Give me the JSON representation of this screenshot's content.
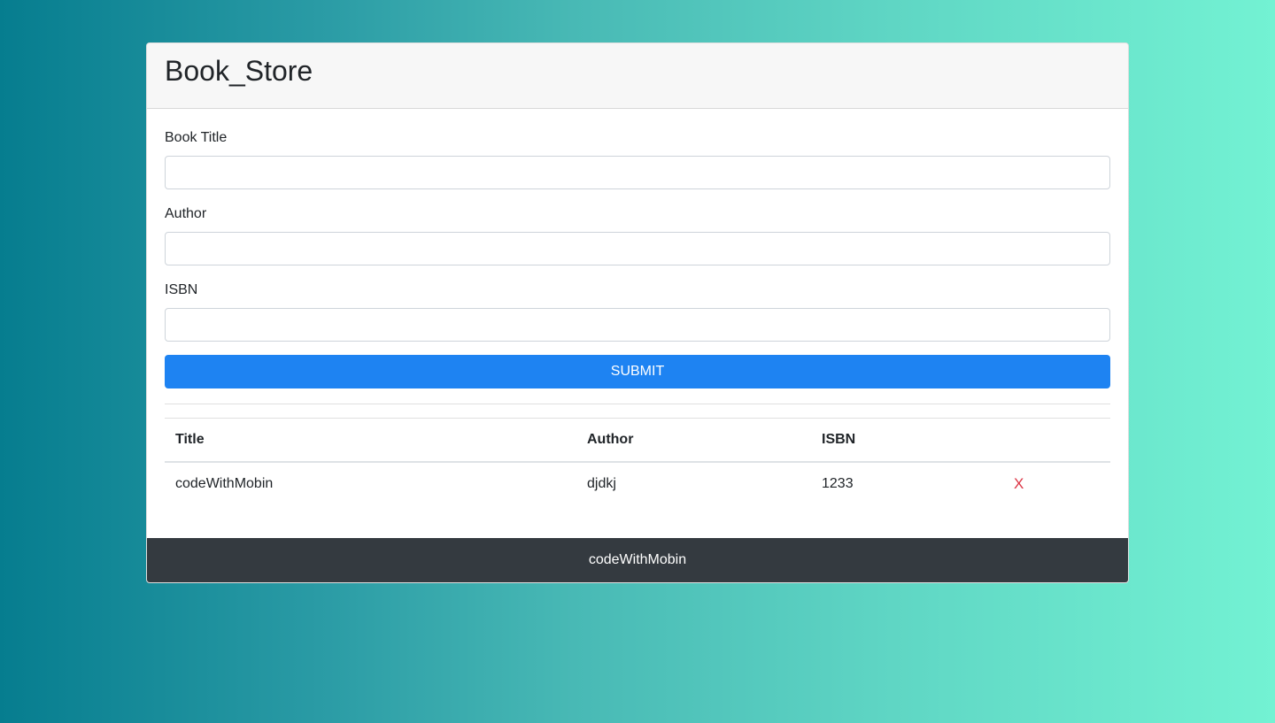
{
  "header": {
    "title": "Book_Store"
  },
  "form": {
    "title_label": "Book Title",
    "title_value": "",
    "author_label": "Author",
    "author_value": "",
    "isbn_label": "ISBN",
    "isbn_value": "",
    "submit_label": "SUBMIT"
  },
  "table": {
    "columns": [
      "Title",
      "Author",
      "ISBN",
      ""
    ],
    "rows": [
      {
        "title": "codeWithMobin",
        "author": "djdkj",
        "isbn": "1233",
        "delete_label": "X"
      }
    ]
  },
  "footer": {
    "text": "codeWithMobin"
  },
  "colors": {
    "accent": "#1e83f2",
    "danger": "#dc3545",
    "footer_bg": "#343a40",
    "gradient_start": "#067d8f",
    "gradient_end": "#73f2d3"
  }
}
